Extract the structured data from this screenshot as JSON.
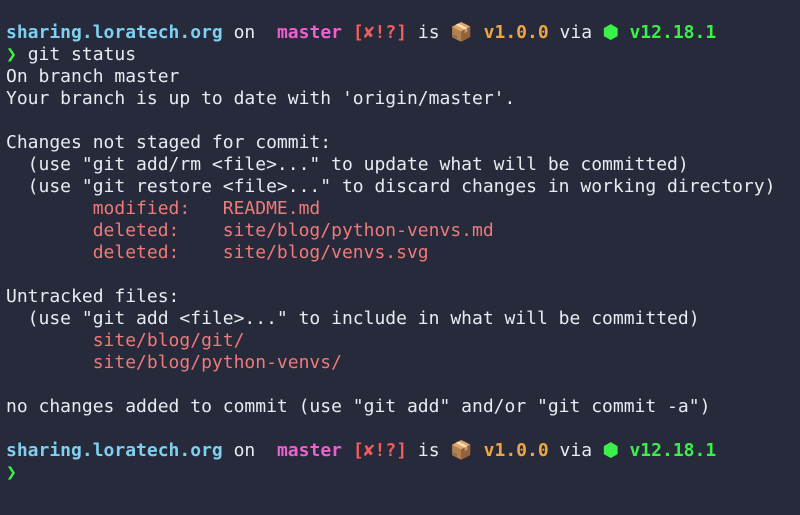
{
  "colors": {
    "background": "#272a3a",
    "text": "#e9ebf2",
    "host": "#7fd0f0",
    "branch": "#f05fcf",
    "git_status": "#ef5d5d",
    "version": "#f0a640",
    "node_version": "#3cf04a",
    "changed_file": "#ef7a7a"
  },
  "icons": {
    "branch": "git-branch-icon",
    "package": "package-box-icon",
    "node": "nodejs-hexagon-icon",
    "prompt": "chevron-right-icon"
  },
  "prompt_1": {
    "host": "sharing.loratech.org",
    "on": "on",
    "branch_glyph": "",
    "branch": "master",
    "git_status": "[✘!?]",
    "is": "is",
    "package_glyph": "📦",
    "version": "v1.0.0",
    "via": "via",
    "node_glyph": "⬢",
    "node_version": "v12.18.1"
  },
  "command": {
    "prompt_symbol": "❯",
    "text": "git status"
  },
  "output": {
    "line_1": "On branch master",
    "line_2": "Your branch is up to date with 'origin/master'.",
    "unstaged_header": "Changes not staged for commit:",
    "unstaged_hint_1": "  (use \"git add/rm <file>...\" to update what will be committed)",
    "unstaged_hint_2": "  (use \"git restore <file>...\" to discard changes in working directory)",
    "unstaged_files": [
      "        modified:   README.md",
      "        deleted:    site/blog/python-venvs.md",
      "        deleted:    site/blog/venvs.svg"
    ],
    "untracked_header": "Untracked files:",
    "untracked_hint": "  (use \"git add <file>...\" to include in what will be committed)",
    "untracked_files": [
      "        site/blog/git/",
      "        site/blog/python-venvs/"
    ],
    "summary": "no changes added to commit (use \"git add\" and/or \"git commit -a\")"
  },
  "prompt_2": {
    "host": "sharing.loratech.org",
    "on": "on",
    "branch_glyph": "",
    "branch": "master",
    "git_status": "[✘!?]",
    "is": "is",
    "package_glyph": "📦",
    "version": "v1.0.0",
    "via": "via",
    "node_glyph": "⬢",
    "node_version": "v12.18.1",
    "prompt_symbol": "❯"
  }
}
